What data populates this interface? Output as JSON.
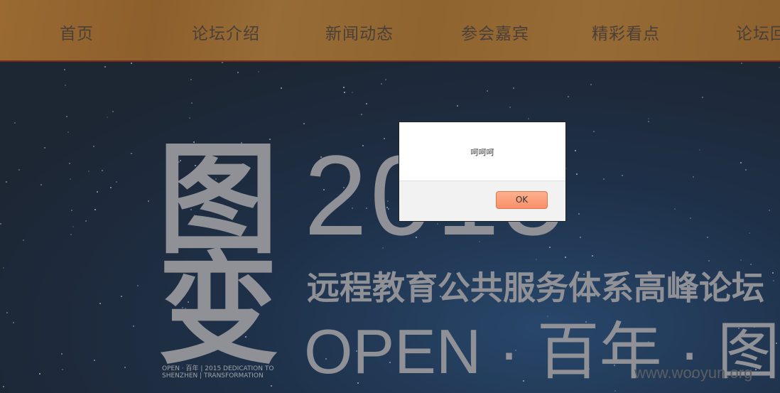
{
  "nav": {
    "items": [
      "首页",
      "论坛介绍",
      "新闻动态",
      "参会嘉宾",
      "精彩看点",
      "论坛回顾"
    ]
  },
  "banner": {
    "logo_char_top": "图",
    "logo_char_bottom": "变",
    "year": "2015",
    "title": "远程教育公共服务体系高峰论坛",
    "slogan": "OPEN · 百年 · 图变",
    "logo_caption_1": "OPEN · 百年",
    "logo_caption_2": "SHENZHEN",
    "logo_caption_3": "2015 DEDICATION TO",
    "logo_caption_4": "TRANSFORMATION",
    "watermark": "www.wooyun.org"
  },
  "dialog": {
    "message": "呵呵呵",
    "ok_label": "OK"
  }
}
